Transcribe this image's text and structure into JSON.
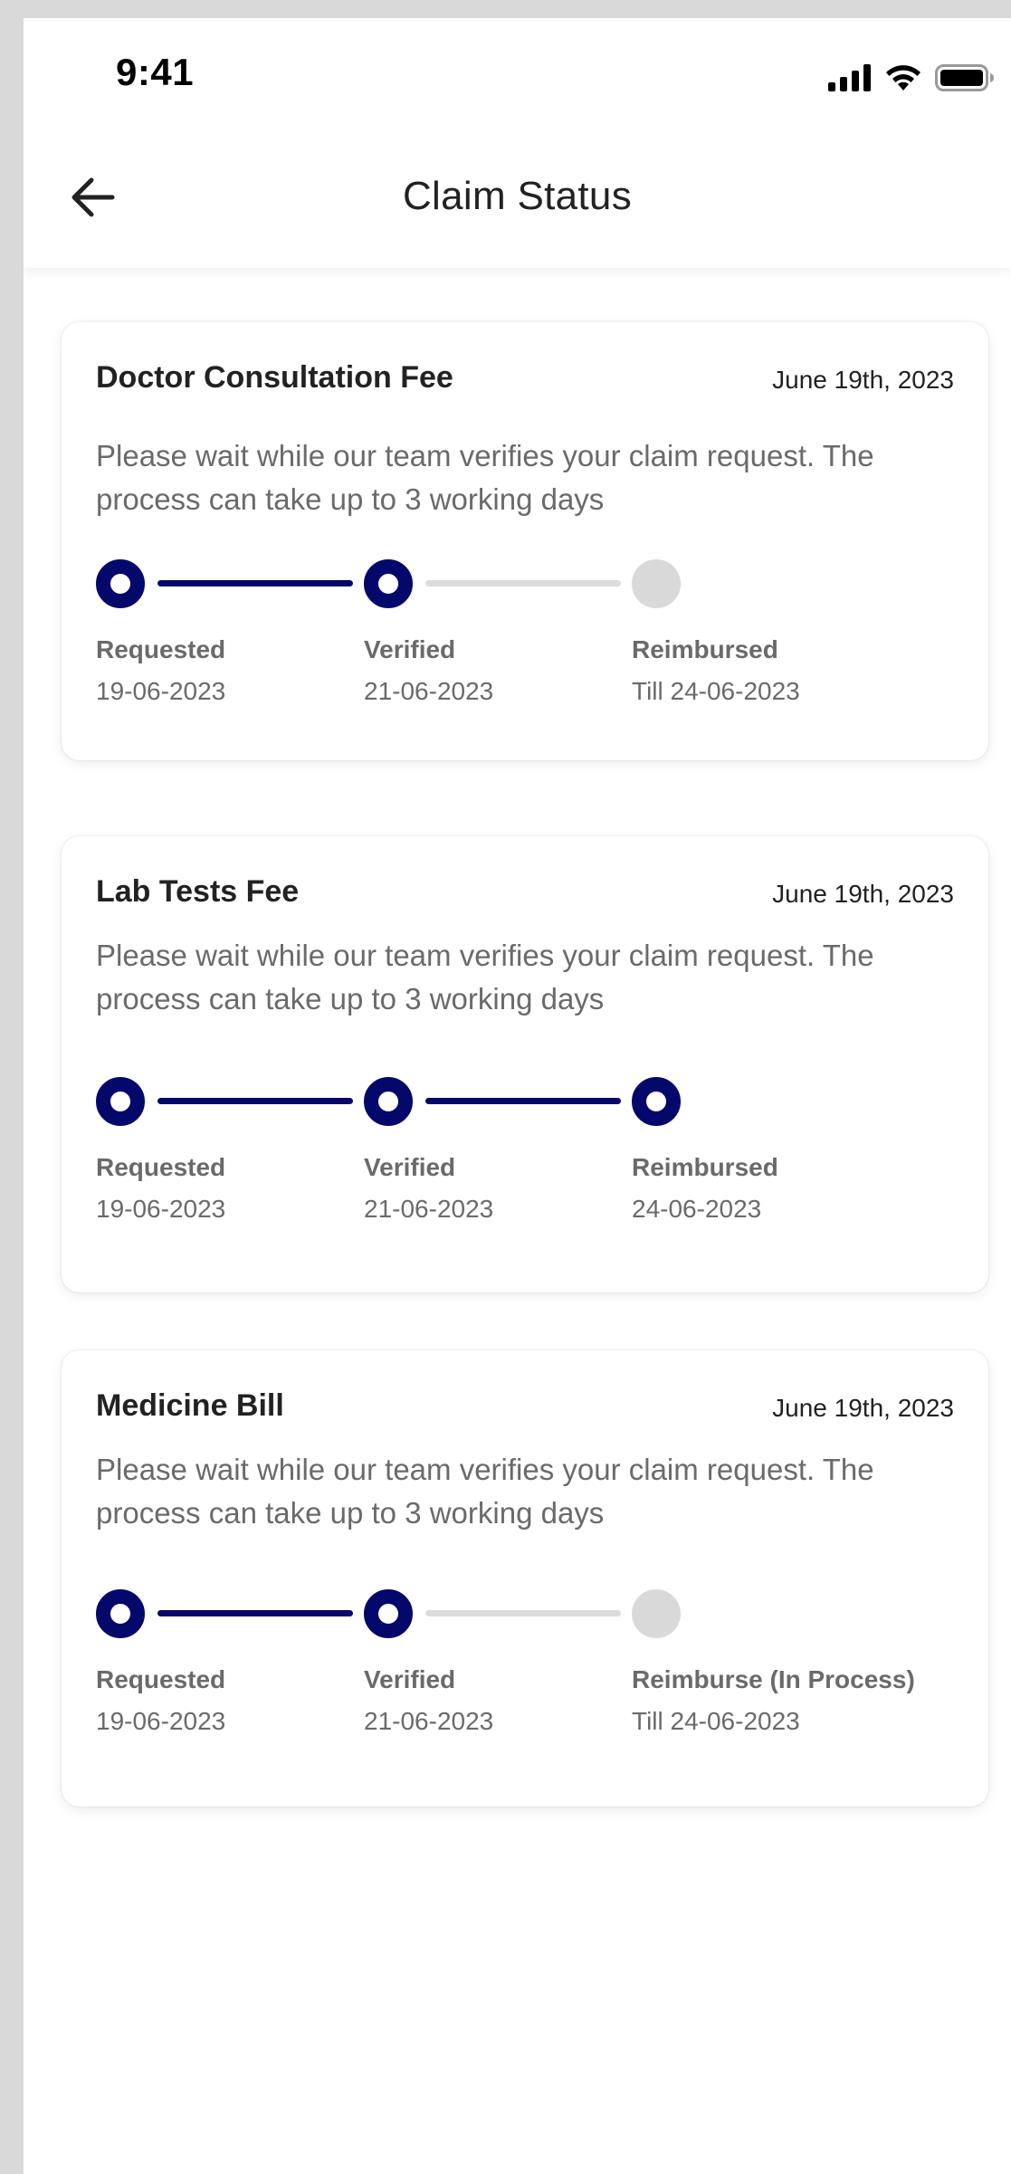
{
  "status_bar": {
    "time": "9:41"
  },
  "header": {
    "title": "Claim Status"
  },
  "colors": {
    "accent": "#05086b",
    "pending": "#d9d9d9"
  },
  "claims": [
    {
      "title": "Doctor Consultation Fee",
      "date": "June 19th, 2023",
      "description": "Please wait while our team verifies your claim request. The process can take up to 3 working days",
      "steps": [
        {
          "label": "Requested",
          "date": "19-06-2023",
          "done": true
        },
        {
          "label": "Verified",
          "date": "21-06-2023",
          "done": true
        },
        {
          "label": "Reimbursed",
          "date": "Till 24-06-2023",
          "done": false
        }
      ]
    },
    {
      "title": "Lab Tests Fee",
      "date": "June 19th, 2023",
      "description": "Please wait while our team verifies your claim request. The process can take up to 3 working days",
      "steps": [
        {
          "label": "Requested",
          "date": "19-06-2023",
          "done": true
        },
        {
          "label": "Verified",
          "date": "21-06-2023",
          "done": true
        },
        {
          "label": "Reimbursed",
          "date": "24-06-2023",
          "done": true
        }
      ]
    },
    {
      "title": "Medicine Bill",
      "date": "June 19th, 2023",
      "description": "Please wait while our team verifies your claim request. The process can take up to 3 working days",
      "steps": [
        {
          "label": "Requested",
          "date": "19-06-2023",
          "done": true
        },
        {
          "label": "Verified",
          "date": "21-06-2023",
          "done": true
        },
        {
          "label": "Reimburse (In Process)",
          "date": "Till 24-06-2023",
          "done": false
        }
      ]
    }
  ]
}
